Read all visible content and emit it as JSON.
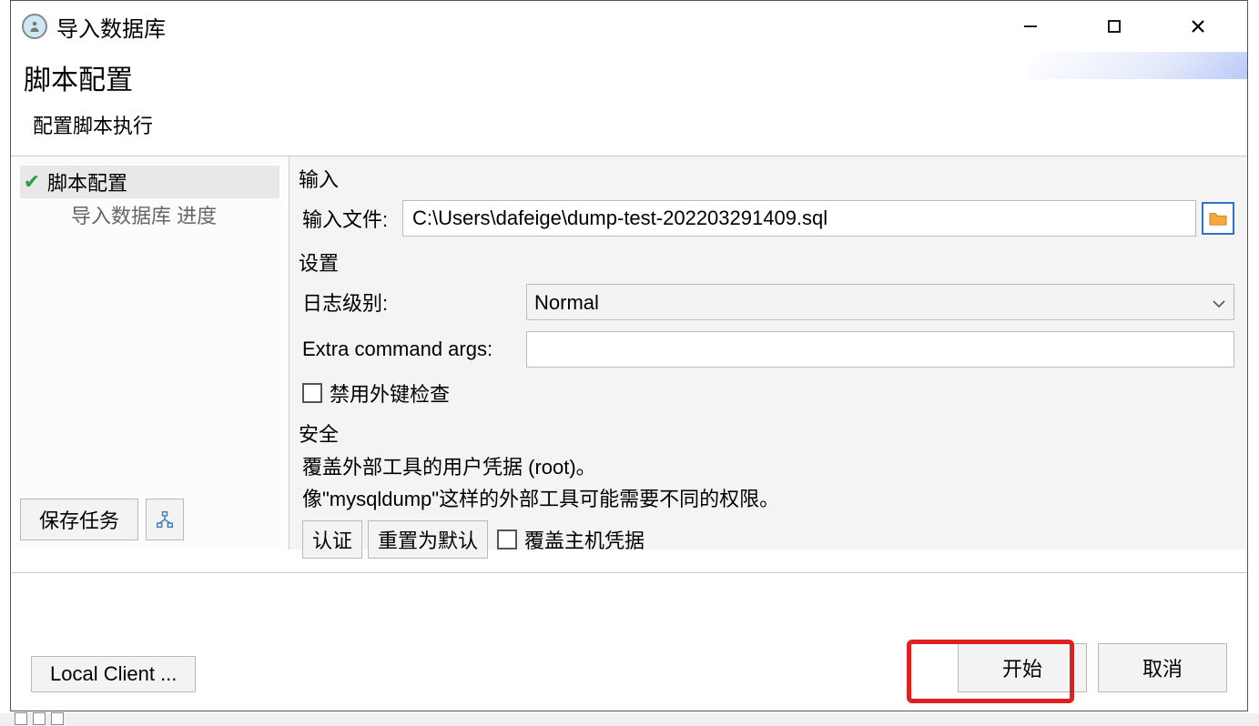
{
  "window": {
    "title": "导入数据库"
  },
  "header": {
    "title": "脚本配置",
    "subtitle": "配置脚本执行"
  },
  "sidebar": {
    "items": [
      {
        "label": "脚本配置",
        "active": true
      },
      {
        "label": "导入数据库 进度"
      }
    ],
    "save_task_label": "保存任务"
  },
  "content": {
    "input_group": {
      "title": "输入",
      "file_label": "输入文件:",
      "file_value": "C:\\Users\\dafeige\\dump-test-202203291409.sql"
    },
    "settings_group": {
      "title": "设置",
      "log_label": "日志级别:",
      "log_value": "Normal",
      "extra_label": "Extra command args:",
      "extra_value": "",
      "fk_check_label": "禁用外键检查"
    },
    "security_group": {
      "title": "安全",
      "line1": "覆盖外部工具的用户凭据 (root)。",
      "line2": "像\"mysqldump\"这样的外部工具可能需要不同的权限。",
      "auth_btn": "认证",
      "reset_btn": "重置为默认",
      "override_host_label": "覆盖主机凭据"
    }
  },
  "footer": {
    "local_client": "Local Client ...",
    "start": "开始",
    "cancel": "取消"
  }
}
